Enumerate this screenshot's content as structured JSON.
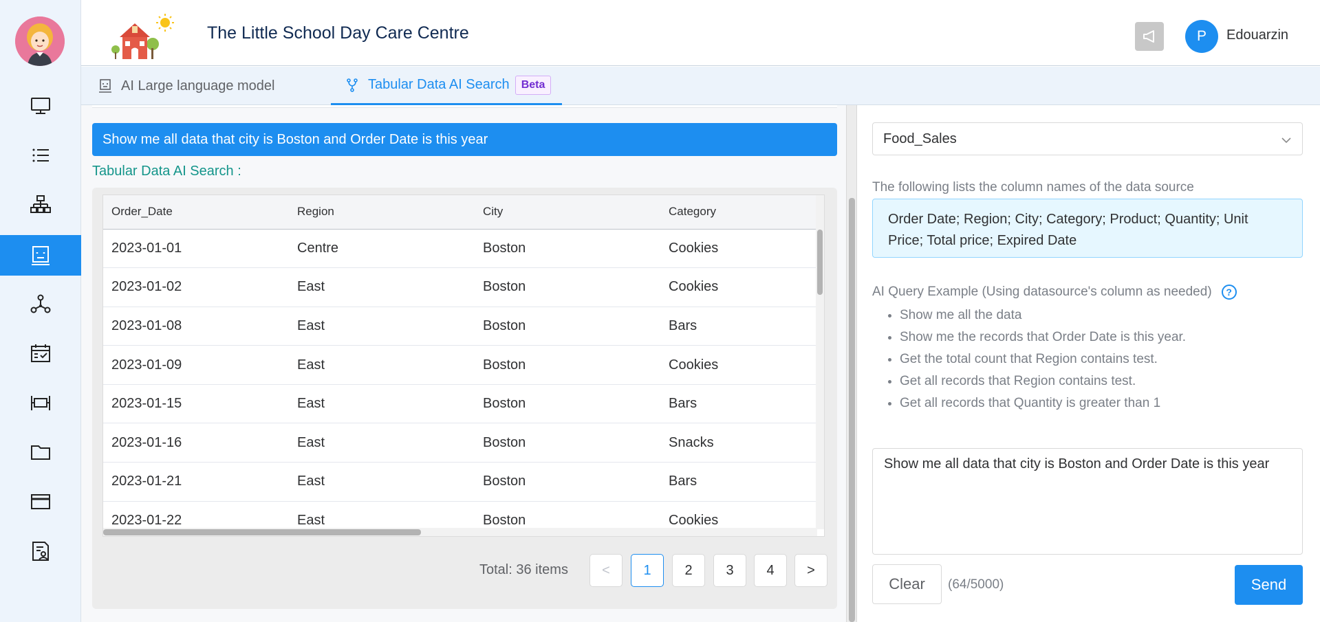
{
  "app": {
    "school_name": "The Little School Day Care Centre",
    "user_initial": "P",
    "user_name": "Edouarzin"
  },
  "sidebar": {
    "items": [
      {
        "icon": "monitor-icon",
        "active": false
      },
      {
        "icon": "list-icon",
        "active": false
      },
      {
        "icon": "org-chart-icon",
        "active": false
      },
      {
        "icon": "robot-icon",
        "active": true
      },
      {
        "icon": "network-icon",
        "active": false
      },
      {
        "icon": "calendar-check-icon",
        "active": false
      },
      {
        "icon": "bed-icon",
        "active": false
      },
      {
        "icon": "folder-icon",
        "active": false
      },
      {
        "icon": "card-icon",
        "active": false
      },
      {
        "icon": "document-user-icon",
        "active": false
      }
    ]
  },
  "tabs": [
    {
      "label": "AI Large language model",
      "icon": "robot-icon",
      "active": false
    },
    {
      "label": "Tabular Data AI Search",
      "icon": "branch-icon",
      "active": true,
      "badge": "Beta"
    }
  ],
  "query": {
    "text": "Show me all data that city is Boston and Order Date is this year",
    "result_label": "Tabular Data AI Search :"
  },
  "table": {
    "columns": [
      "Order_Date",
      "Region",
      "City",
      "Category"
    ],
    "rows": [
      [
        "2023-01-01",
        "Centre",
        "Boston",
        "Cookies"
      ],
      [
        "2023-01-02",
        "East",
        "Boston",
        "Cookies"
      ],
      [
        "2023-01-08",
        "East",
        "Boston",
        "Bars"
      ],
      [
        "2023-01-09",
        "East",
        "Boston",
        "Cookies"
      ],
      [
        "2023-01-15",
        "East",
        "Boston",
        "Bars"
      ],
      [
        "2023-01-16",
        "East",
        "Boston",
        "Snacks"
      ],
      [
        "2023-01-21",
        "East",
        "Boston",
        "Bars"
      ],
      [
        "2023-01-22",
        "East",
        "Boston",
        "Cookies"
      ]
    ]
  },
  "pagination": {
    "total_label": "Total: 36 items",
    "prev": "<",
    "next": ">",
    "pages": [
      "1",
      "2",
      "3",
      "4"
    ],
    "current": "1"
  },
  "datasource": {
    "selected": "Food_Sales",
    "hint": "The following lists the column names of the data source",
    "columns_text": "Order Date; Region; City; Category; Product; Quantity; Unit Price; Total price; Expired Date"
  },
  "examples": {
    "title": "AI Query Example (Using datasource's column as needed)",
    "items": [
      "Show me all the data",
      "Show me the records that Order Date is this year.",
      "Get the total count that Region contains test.",
      "Get all records that Region contains test.",
      "Get all records that Quantity is greater than 1"
    ]
  },
  "composer": {
    "value": "Show me all data that city is Boston and Order Date is this year",
    "clear_label": "Clear",
    "counter": "(64/5000)",
    "send_label": "Send"
  },
  "colors": {
    "accent": "#1d8ef0",
    "result_label": "#14958a",
    "beta": "#722ed1"
  }
}
